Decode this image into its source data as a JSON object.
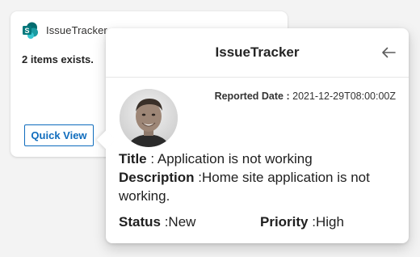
{
  "card": {
    "app_name": "IssueTracker",
    "message": "2 items exists.",
    "quick_view_label": "Quick View",
    "icon": "sharepoint-icon"
  },
  "popover": {
    "title": "IssueTracker",
    "back_icon": "back-arrow-icon",
    "reported_label": "Reported Date :",
    "reported_value": "2021-12-29T08:00:00Z",
    "title_label": "Title",
    "title_value": " : Application is not working",
    "description_label": "Description",
    "description_value": " :Home site application is not working.",
    "status_label": "Status",
    "status_value": " :New",
    "priority_label": "Priority",
    "priority_value": " :High"
  },
  "colors": {
    "accent": "#0f6cbd",
    "sharepoint_teal": "#036c70",
    "background": "#f3f3f3"
  }
}
